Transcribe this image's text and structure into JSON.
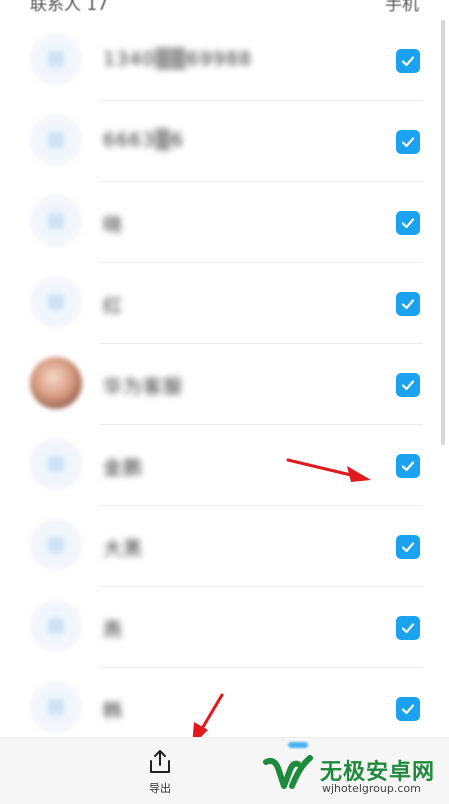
{
  "header": {
    "left_label": "联系人 17",
    "right_label": "手机"
  },
  "contacts": [
    {
      "name": "1340▒▒69988",
      "avatar": "default",
      "checked": true
    },
    {
      "name": "6663▒6",
      "avatar": "default",
      "checked": true
    },
    {
      "name": "晓",
      "avatar": "default",
      "checked": true
    },
    {
      "name": "红",
      "avatar": "default",
      "checked": true
    },
    {
      "name": "华为客服",
      "avatar": "photo",
      "checked": true
    },
    {
      "name": "金鹏",
      "avatar": "default",
      "checked": true
    },
    {
      "name": "大黑",
      "avatar": "default",
      "checked": true
    },
    {
      "name": "燕",
      "avatar": "default",
      "checked": true
    },
    {
      "name": "韩",
      "avatar": "default",
      "checked": true
    }
  ],
  "bottom_bar": {
    "export_label": "导出"
  },
  "watermark": {
    "title": "无极安卓网",
    "url": "wjhotelgroup.com"
  },
  "colors": {
    "checkbox": "#1aa2f0",
    "annotation_arrow": "#e3181d",
    "watermark_green": "#1e8a3c"
  },
  "icons": {
    "checkbox": "checkmark-icon",
    "export": "share-upload-icon",
    "arrow": "red-pointer-arrow"
  }
}
